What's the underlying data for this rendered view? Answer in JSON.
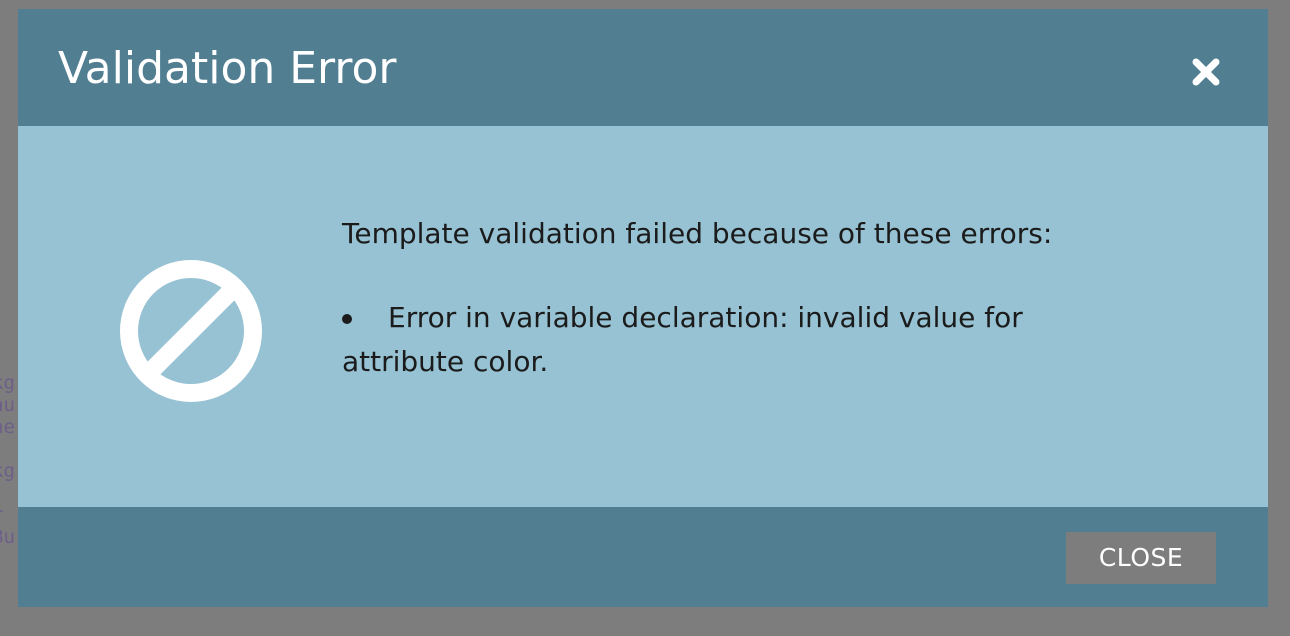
{
  "background": {
    "code_fragments": [
      "kg",
      "au",
      "he",
      "",
      "kg",
      "",
      "r",
      "Bu"
    ],
    "overlay_color": "#7d7d7d"
  },
  "dialog": {
    "title": "Validation Error",
    "close_icon": "close-x-icon",
    "status_icon": "prohibited-icon",
    "message_intro": "Template validation failed because of these errors:",
    "errors": [
      "Error in variable declaration: invalid value for attribute color."
    ],
    "close_button_label": "CLOSE",
    "colors": {
      "header": "#517e90",
      "body": "#96c2d3",
      "footer": "#517e90",
      "button": "#7d7d7d",
      "text": "#1b1b1b",
      "title_text": "#ffffff"
    }
  }
}
